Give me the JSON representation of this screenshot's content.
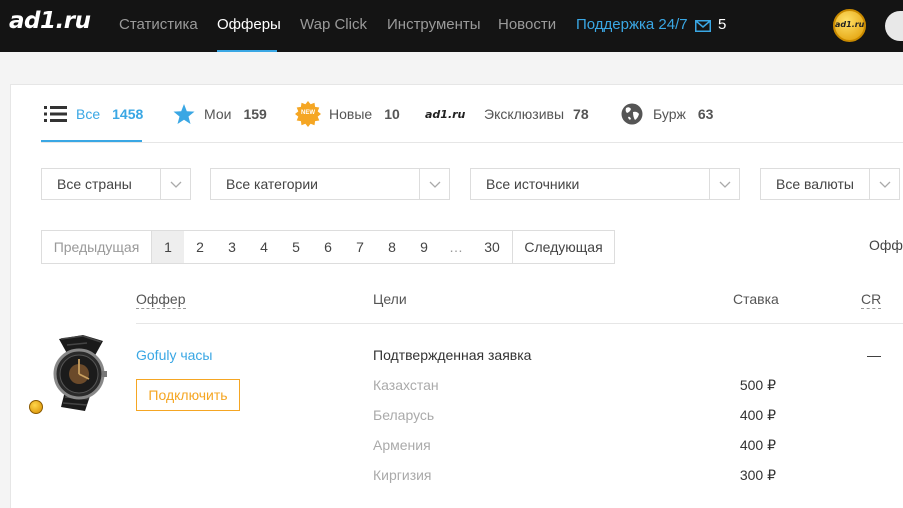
{
  "brand": {
    "logo": "ad1.ru",
    "avatar_text": "ad1.ru"
  },
  "nav": {
    "items": [
      "Статистика",
      "Офферы",
      "Wap Click",
      "Инструменты",
      "Новости"
    ],
    "support": "Поддержка 24/7",
    "mail_count": "5"
  },
  "tabs": [
    {
      "label": "Все",
      "count": "1458"
    },
    {
      "label": "Мои",
      "count": "159"
    },
    {
      "label": "Новые",
      "count": "10",
      "badge": "NEW"
    },
    {
      "label": "ad1.ru"
    },
    {
      "label": "Эксклюзивы",
      "count": "78"
    },
    {
      "label": "Бурж",
      "count": "63"
    }
  ],
  "filters": [
    "Все страны",
    "Все категории",
    "Все источники",
    "Все валюты"
  ],
  "pagination": {
    "prev": "Предыдущая",
    "pages": [
      "1",
      "2",
      "3",
      "4",
      "5",
      "6",
      "7",
      "8",
      "9",
      "…",
      "30"
    ],
    "next": "Следующая",
    "right_label": "Офф"
  },
  "table": {
    "headers": {
      "offer": "Оффер",
      "goals": "Цели",
      "rate": "Ставка",
      "cr": "CR"
    },
    "offer": {
      "name": "Gofuly часы",
      "connect": "Подключить",
      "goal": "Подтвержденная заявка",
      "cr": "—",
      "geos": [
        {
          "country": "Казахстан",
          "rate": "500 ₽"
        },
        {
          "country": "Беларусь",
          "rate": "400 ₽"
        },
        {
          "country": "Армения",
          "rate": "400 ₽"
        },
        {
          "country": "Киргизия",
          "rate": "300 ₽"
        }
      ]
    }
  },
  "colors": {
    "accent": "#3aa7e4",
    "orange": "#f5a623",
    "topbar": "#141414"
  }
}
